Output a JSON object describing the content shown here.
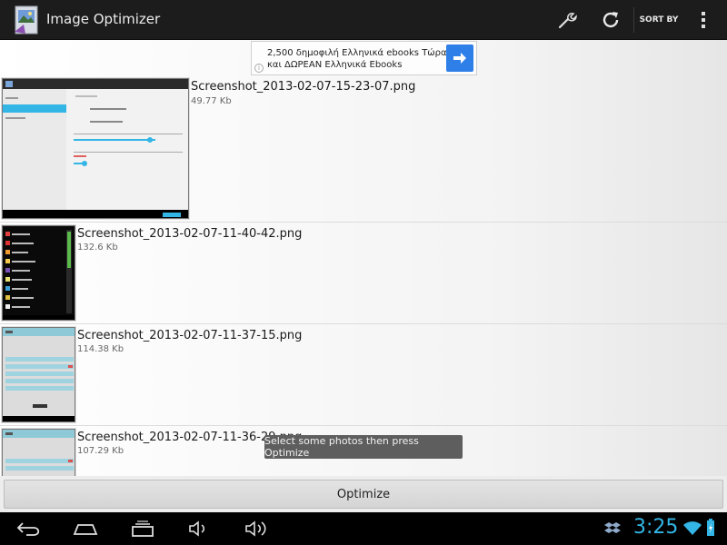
{
  "app": {
    "title": "Image Optimizer"
  },
  "actionbar": {
    "sort_label": "SORT BY"
  },
  "ad": {
    "line1": "2,500 δημοφιλή Ελληνικά ebooks Τώρα",
    "line2": "και ΔΩΡΕΑΝ Ελληνικά Ebooks",
    "info": "i"
  },
  "files": [
    {
      "name": "Screenshot_2013-02-07-15-23-07.png",
      "size": "49.77 Kb"
    },
    {
      "name": "Screenshot_2013-02-07-11-40-42.png",
      "size": "132.6 Kb"
    },
    {
      "name": "Screenshot_2013-02-07-11-37-15.png",
      "size": "114.38 Kb"
    },
    {
      "name": "Screenshot_2013-02-07-11-36-29.png",
      "size": "107.29 Kb"
    }
  ],
  "toast": "Select some photos then press Optimize",
  "optimize_label": "Optimize",
  "status": {
    "time": "3:25"
  },
  "colors": {
    "accent": "#33b5e5",
    "actionbar": "#1c1c1c",
    "ad_button": "#2f7fe8"
  }
}
